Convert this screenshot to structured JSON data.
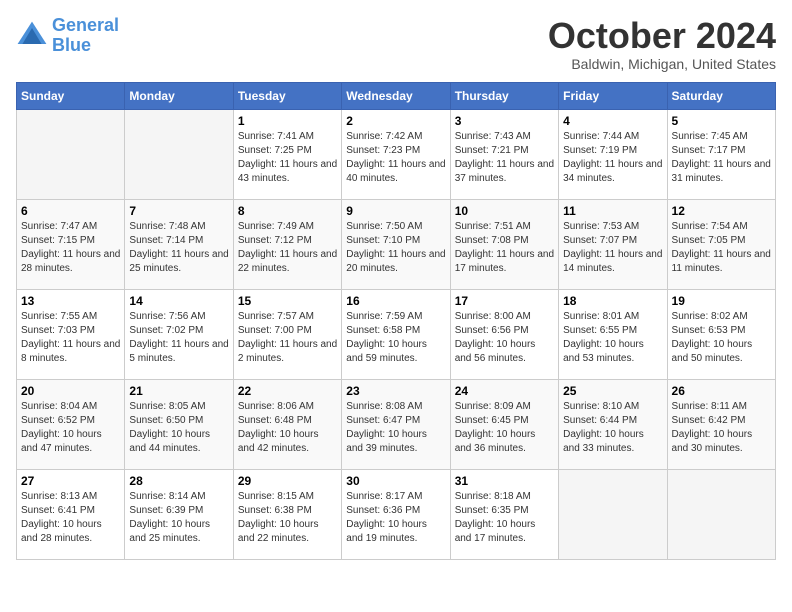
{
  "header": {
    "logo_line1": "General",
    "logo_line2": "Blue",
    "month": "October 2024",
    "location": "Baldwin, Michigan, United States"
  },
  "weekdays": [
    "Sunday",
    "Monday",
    "Tuesday",
    "Wednesday",
    "Thursday",
    "Friday",
    "Saturday"
  ],
  "weeks": [
    [
      {
        "day": "",
        "sunrise": "",
        "sunset": "",
        "daylight": ""
      },
      {
        "day": "",
        "sunrise": "",
        "sunset": "",
        "daylight": ""
      },
      {
        "day": "1",
        "sunrise": "Sunrise: 7:41 AM",
        "sunset": "Sunset: 7:25 PM",
        "daylight": "Daylight: 11 hours and 43 minutes."
      },
      {
        "day": "2",
        "sunrise": "Sunrise: 7:42 AM",
        "sunset": "Sunset: 7:23 PM",
        "daylight": "Daylight: 11 hours and 40 minutes."
      },
      {
        "day": "3",
        "sunrise": "Sunrise: 7:43 AM",
        "sunset": "Sunset: 7:21 PM",
        "daylight": "Daylight: 11 hours and 37 minutes."
      },
      {
        "day": "4",
        "sunrise": "Sunrise: 7:44 AM",
        "sunset": "Sunset: 7:19 PM",
        "daylight": "Daylight: 11 hours and 34 minutes."
      },
      {
        "day": "5",
        "sunrise": "Sunrise: 7:45 AM",
        "sunset": "Sunset: 7:17 PM",
        "daylight": "Daylight: 11 hours and 31 minutes."
      }
    ],
    [
      {
        "day": "6",
        "sunrise": "Sunrise: 7:47 AM",
        "sunset": "Sunset: 7:15 PM",
        "daylight": "Daylight: 11 hours and 28 minutes."
      },
      {
        "day": "7",
        "sunrise": "Sunrise: 7:48 AM",
        "sunset": "Sunset: 7:14 PM",
        "daylight": "Daylight: 11 hours and 25 minutes."
      },
      {
        "day": "8",
        "sunrise": "Sunrise: 7:49 AM",
        "sunset": "Sunset: 7:12 PM",
        "daylight": "Daylight: 11 hours and 22 minutes."
      },
      {
        "day": "9",
        "sunrise": "Sunrise: 7:50 AM",
        "sunset": "Sunset: 7:10 PM",
        "daylight": "Daylight: 11 hours and 20 minutes."
      },
      {
        "day": "10",
        "sunrise": "Sunrise: 7:51 AM",
        "sunset": "Sunset: 7:08 PM",
        "daylight": "Daylight: 11 hours and 17 minutes."
      },
      {
        "day": "11",
        "sunrise": "Sunrise: 7:53 AM",
        "sunset": "Sunset: 7:07 PM",
        "daylight": "Daylight: 11 hours and 14 minutes."
      },
      {
        "day": "12",
        "sunrise": "Sunrise: 7:54 AM",
        "sunset": "Sunset: 7:05 PM",
        "daylight": "Daylight: 11 hours and 11 minutes."
      }
    ],
    [
      {
        "day": "13",
        "sunrise": "Sunrise: 7:55 AM",
        "sunset": "Sunset: 7:03 PM",
        "daylight": "Daylight: 11 hours and 8 minutes."
      },
      {
        "day": "14",
        "sunrise": "Sunrise: 7:56 AM",
        "sunset": "Sunset: 7:02 PM",
        "daylight": "Daylight: 11 hours and 5 minutes."
      },
      {
        "day": "15",
        "sunrise": "Sunrise: 7:57 AM",
        "sunset": "Sunset: 7:00 PM",
        "daylight": "Daylight: 11 hours and 2 minutes."
      },
      {
        "day": "16",
        "sunrise": "Sunrise: 7:59 AM",
        "sunset": "Sunset: 6:58 PM",
        "daylight": "Daylight: 10 hours and 59 minutes."
      },
      {
        "day": "17",
        "sunrise": "Sunrise: 8:00 AM",
        "sunset": "Sunset: 6:56 PM",
        "daylight": "Daylight: 10 hours and 56 minutes."
      },
      {
        "day": "18",
        "sunrise": "Sunrise: 8:01 AM",
        "sunset": "Sunset: 6:55 PM",
        "daylight": "Daylight: 10 hours and 53 minutes."
      },
      {
        "day": "19",
        "sunrise": "Sunrise: 8:02 AM",
        "sunset": "Sunset: 6:53 PM",
        "daylight": "Daylight: 10 hours and 50 minutes."
      }
    ],
    [
      {
        "day": "20",
        "sunrise": "Sunrise: 8:04 AM",
        "sunset": "Sunset: 6:52 PM",
        "daylight": "Daylight: 10 hours and 47 minutes."
      },
      {
        "day": "21",
        "sunrise": "Sunrise: 8:05 AM",
        "sunset": "Sunset: 6:50 PM",
        "daylight": "Daylight: 10 hours and 44 minutes."
      },
      {
        "day": "22",
        "sunrise": "Sunrise: 8:06 AM",
        "sunset": "Sunset: 6:48 PM",
        "daylight": "Daylight: 10 hours and 42 minutes."
      },
      {
        "day": "23",
        "sunrise": "Sunrise: 8:08 AM",
        "sunset": "Sunset: 6:47 PM",
        "daylight": "Daylight: 10 hours and 39 minutes."
      },
      {
        "day": "24",
        "sunrise": "Sunrise: 8:09 AM",
        "sunset": "Sunset: 6:45 PM",
        "daylight": "Daylight: 10 hours and 36 minutes."
      },
      {
        "day": "25",
        "sunrise": "Sunrise: 8:10 AM",
        "sunset": "Sunset: 6:44 PM",
        "daylight": "Daylight: 10 hours and 33 minutes."
      },
      {
        "day": "26",
        "sunrise": "Sunrise: 8:11 AM",
        "sunset": "Sunset: 6:42 PM",
        "daylight": "Daylight: 10 hours and 30 minutes."
      }
    ],
    [
      {
        "day": "27",
        "sunrise": "Sunrise: 8:13 AM",
        "sunset": "Sunset: 6:41 PM",
        "daylight": "Daylight: 10 hours and 28 minutes."
      },
      {
        "day": "28",
        "sunrise": "Sunrise: 8:14 AM",
        "sunset": "Sunset: 6:39 PM",
        "daylight": "Daylight: 10 hours and 25 minutes."
      },
      {
        "day": "29",
        "sunrise": "Sunrise: 8:15 AM",
        "sunset": "Sunset: 6:38 PM",
        "daylight": "Daylight: 10 hours and 22 minutes."
      },
      {
        "day": "30",
        "sunrise": "Sunrise: 8:17 AM",
        "sunset": "Sunset: 6:36 PM",
        "daylight": "Daylight: 10 hours and 19 minutes."
      },
      {
        "day": "31",
        "sunrise": "Sunrise: 8:18 AM",
        "sunset": "Sunset: 6:35 PM",
        "daylight": "Daylight: 10 hours and 17 minutes."
      },
      {
        "day": "",
        "sunrise": "",
        "sunset": "",
        "daylight": ""
      },
      {
        "day": "",
        "sunrise": "",
        "sunset": "",
        "daylight": ""
      }
    ]
  ]
}
